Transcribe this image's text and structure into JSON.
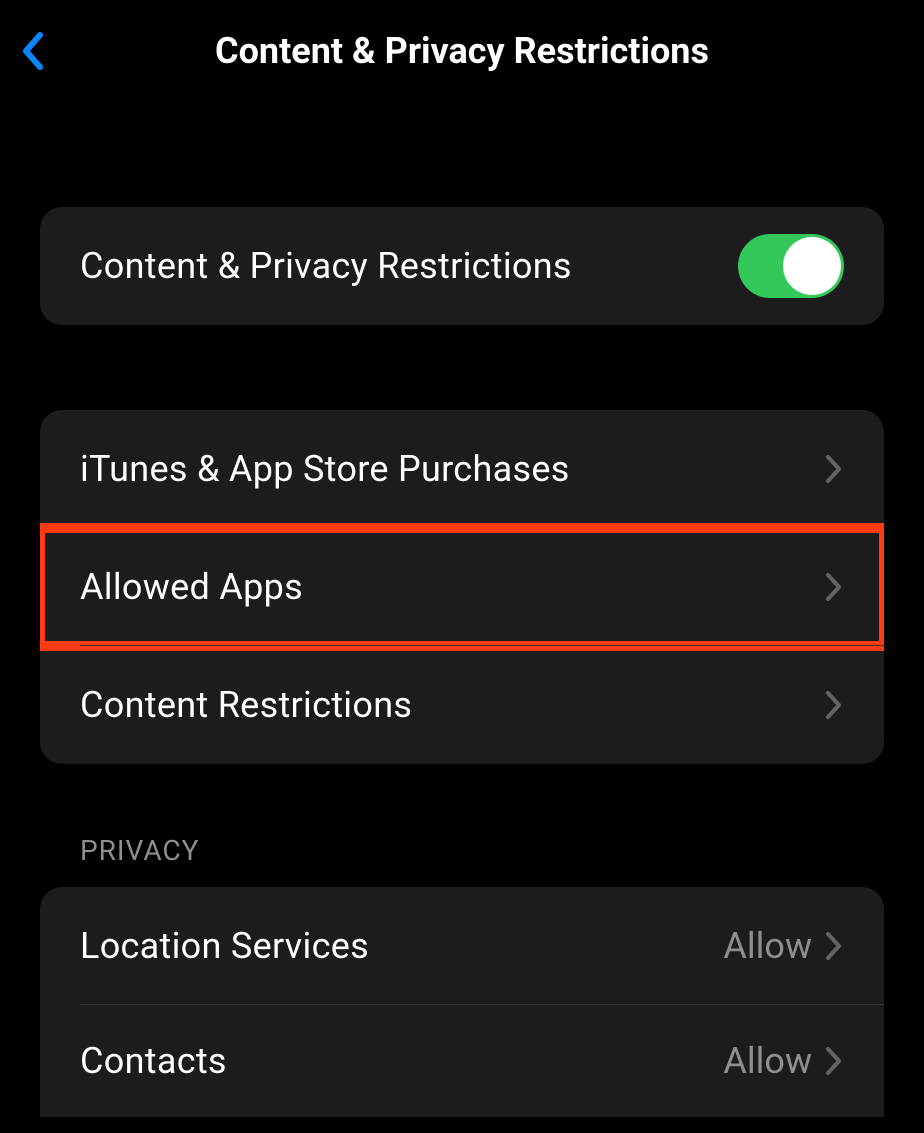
{
  "header": {
    "title": "Content & Privacy Restrictions"
  },
  "toggleGroup": {
    "label": "Content & Privacy Restrictions",
    "enabled": true
  },
  "mainGroup": {
    "items": [
      {
        "label": "iTunes & App Store Purchases"
      },
      {
        "label": "Allowed Apps"
      },
      {
        "label": "Content Restrictions"
      }
    ]
  },
  "privacySection": {
    "header": "PRIVACY",
    "items": [
      {
        "label": "Location Services",
        "value": "Allow"
      },
      {
        "label": "Contacts",
        "value": "Allow"
      }
    ]
  }
}
